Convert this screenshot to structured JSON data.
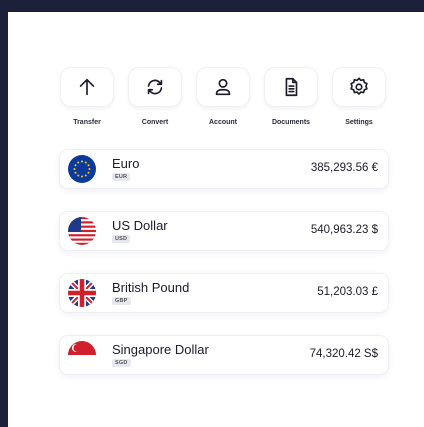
{
  "actions": [
    {
      "label": "Transfer",
      "icon": "arrow-up-icon"
    },
    {
      "label": "Convert",
      "icon": "convert-icon"
    },
    {
      "label": "Account",
      "icon": "user-icon"
    },
    {
      "label": "Documents",
      "icon": "document-icon"
    },
    {
      "label": "Settings",
      "icon": "gear-icon"
    }
  ],
  "currencies": [
    {
      "name": "Euro",
      "code": "EUR",
      "amount": "385,293.56 €",
      "flag": "eu-flag-icon"
    },
    {
      "name": "US Dollar",
      "code": "USD",
      "amount": "540,963.23 $",
      "flag": "us-flag-icon"
    },
    {
      "name": "British Pound",
      "code": "GBP",
      "amount": "51,203.03 £",
      "flag": "uk-flag-icon"
    },
    {
      "name": "Singapore Dollar",
      "code": "SGD",
      "amount": "74,320.42 S$",
      "flag": "sg-flag-icon"
    }
  ],
  "colors": {
    "frame": "#1b1f3a",
    "card": "#ffffff",
    "eu_blue": "#0b3a9c",
    "eu_star": "#ffcc00",
    "red": "#d0202e"
  }
}
